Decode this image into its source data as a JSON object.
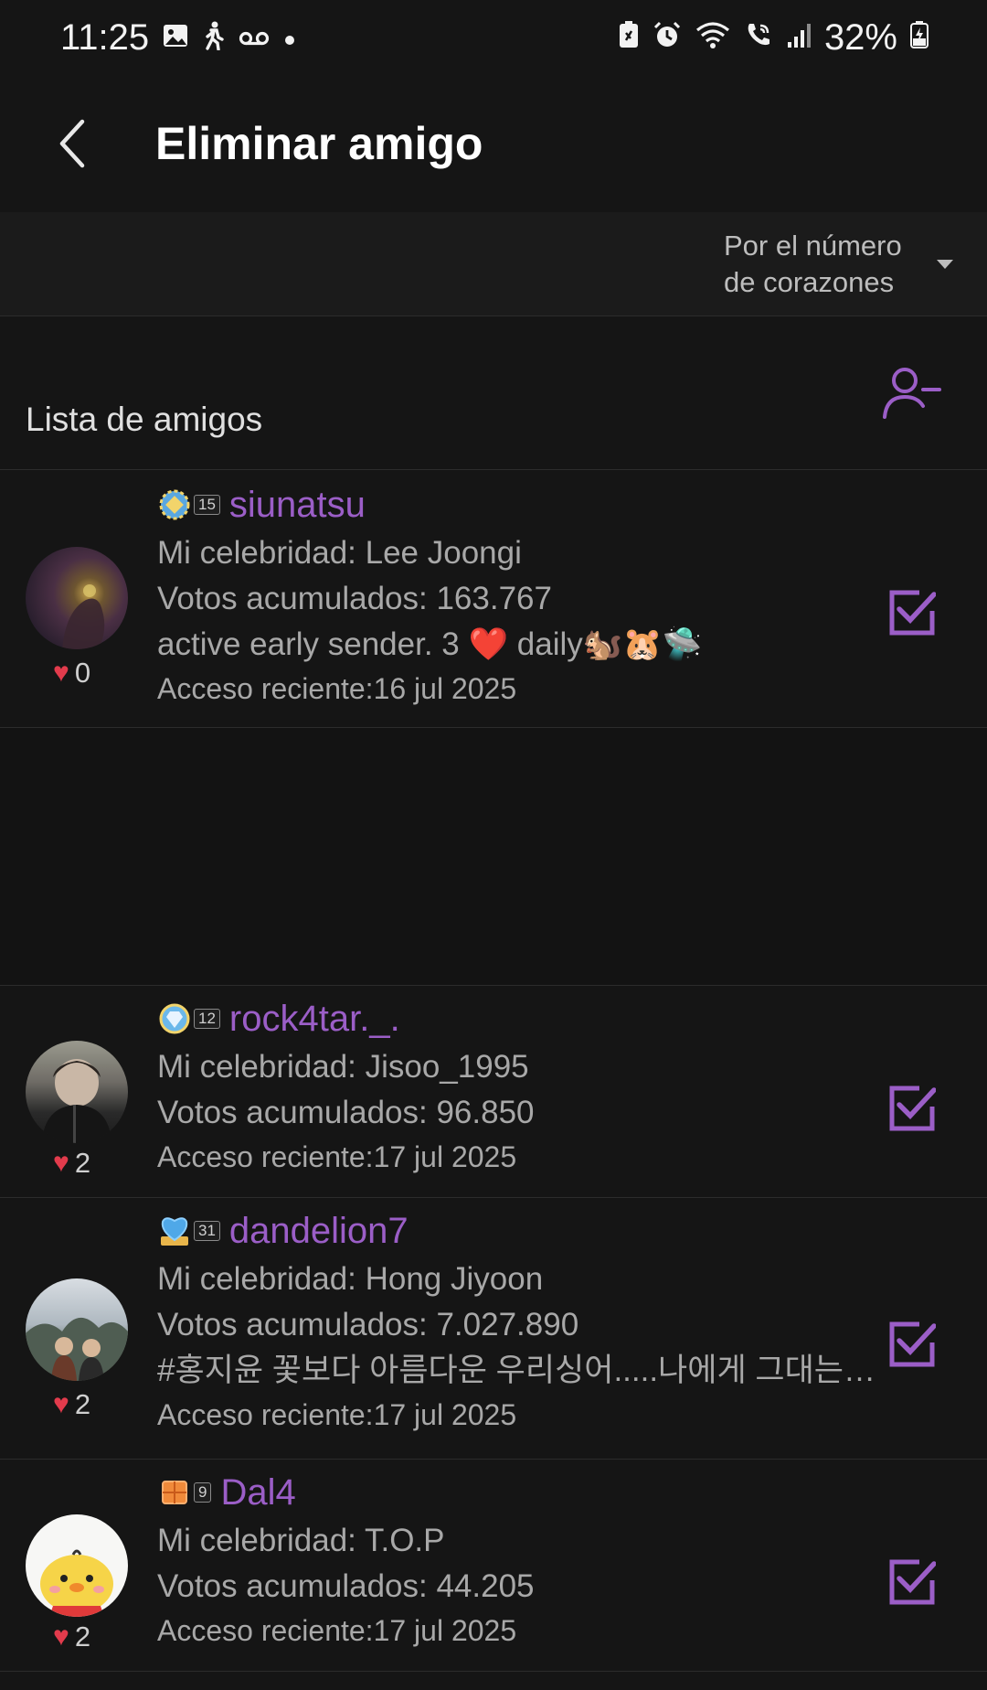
{
  "status_bar": {
    "time": "11:25",
    "battery": "32%",
    "left_icons": [
      "image-icon",
      "walk-icon",
      "voicemail-icon",
      "dot-icon"
    ],
    "right_icons": [
      "battery-saver-icon",
      "alarm-icon",
      "wifi-icon",
      "wifi-call-icon",
      "signal-icon",
      "battery-charging-icon"
    ]
  },
  "header": {
    "title": "Eliminar amigo",
    "back_icon": "chevron-left-icon"
  },
  "sort": {
    "label": "Por el número de corazones",
    "icon": "caret-down-icon"
  },
  "list": {
    "title": "Lista de amigos",
    "remove_icon": "remove-person-icon"
  },
  "colors": {
    "accent": "#9b5ec7",
    "heart": "#e23b4c",
    "background": "#151515"
  },
  "friends": [
    {
      "level": "15",
      "username": "siunatsu",
      "celebrity": "Mi celebridad: Lee Joongi",
      "votes": "Votos acumulados: 163.767",
      "status_text": "active early sender. 3 ❤️ daily🐿️🐹🛸",
      "access": "Acceso reciente:16 jul 2025",
      "hearts": "0",
      "checked": true
    },
    {
      "level": "12",
      "username": "rock4tar._.",
      "celebrity": "Mi celebridad: Jisoo_1995",
      "votes": "Votos acumulados: 96.850",
      "access": "Acceso reciente:17 jul 2025",
      "hearts": "2",
      "checked": true
    },
    {
      "level": "31",
      "username": "dandelion7",
      "celebrity": "Mi celebridad: Hong Jiyoon",
      "votes": "Votos acumulados: 7.027.890",
      "status_text": "#홍지윤 꽃보다 아름다운 우리싱어.....나에게 그대는 …",
      "access": "Acceso reciente:17 jul 2025",
      "hearts": "2",
      "checked": true
    },
    {
      "level": "9",
      "username": "Dal4",
      "celebrity": "Mi celebridad: T.O.P",
      "votes": "Votos acumulados: 44.205",
      "access": "Acceso reciente:17 jul 2025",
      "hearts": "2",
      "checked": true
    }
  ]
}
